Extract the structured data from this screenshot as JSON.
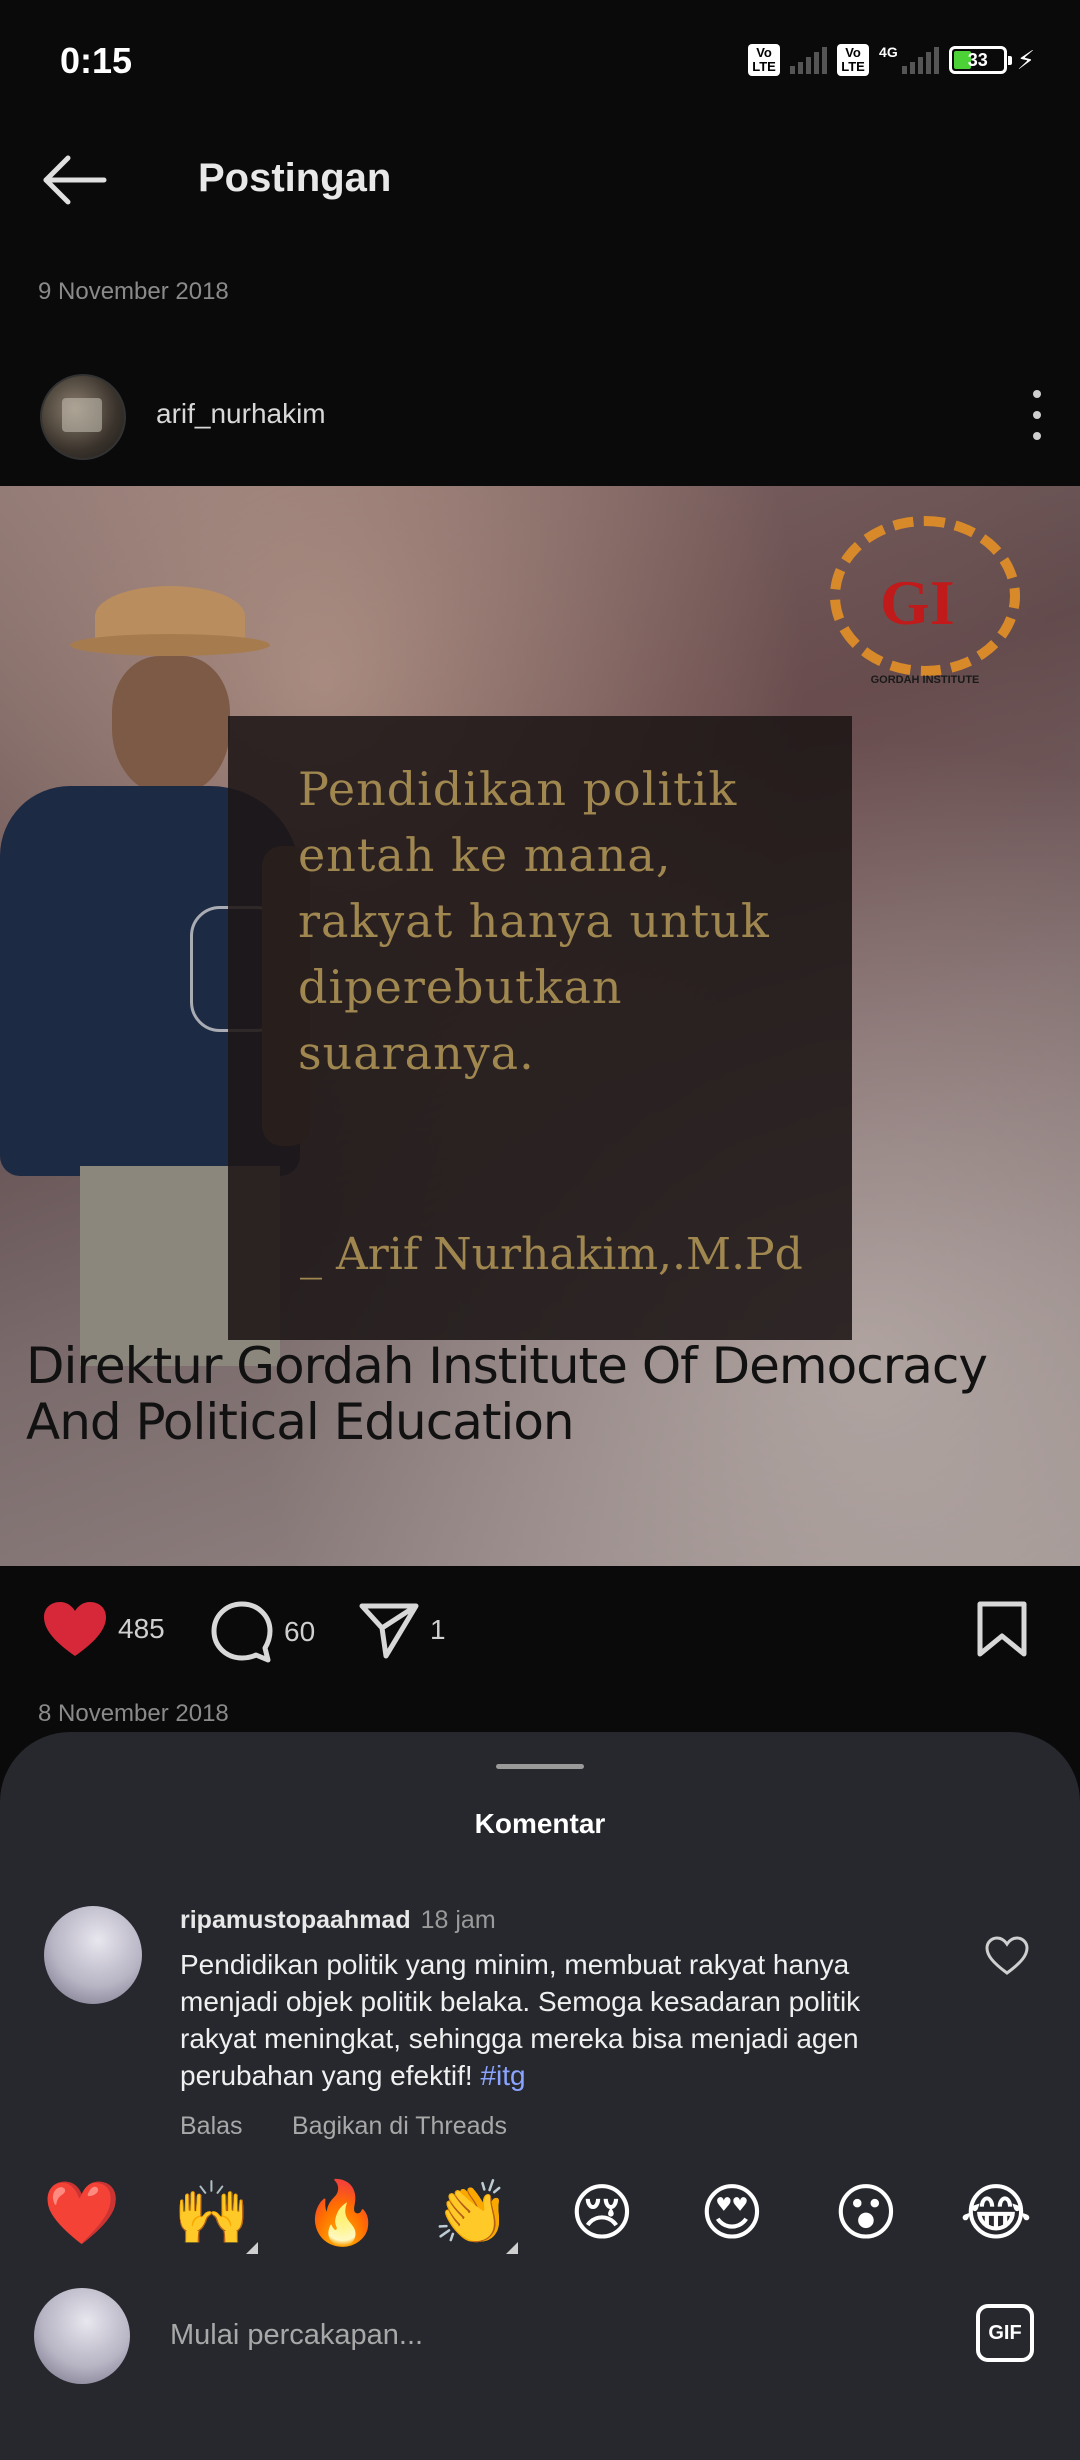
{
  "status_bar": {
    "time": "0:15",
    "volte": "Vo LTE",
    "network": "4G",
    "battery": "33"
  },
  "header": {
    "back_icon": "arrow-left-icon",
    "title": "Postingan"
  },
  "post": {
    "date_top": "9 November 2018",
    "author": "arif_nurhakim",
    "image": {
      "quote": "Pendidikan politik entah ke mana, rakyat hanya untuk diperebutkan suaranya.",
      "quote_author": "_ Arif Nurhakim,.M.Pd",
      "caption": "Direktur Gordah Institute Of Democracy And Political Education",
      "logo_letters": "GI",
      "logo_text": "GORDAH INSTITUTE"
    },
    "likes": "485",
    "comments": "60",
    "shares": "1",
    "date_bottom": "8 November 2018"
  },
  "comments_sheet": {
    "title": "Komentar",
    "comment": {
      "user": "ripamustopaahmad",
      "time": "18 jam",
      "text": "Pendidikan politik yang minim, membuat rakyat hanya menjadi objek politik belaka. Semoga kesadaran politik rakyat meningkat, sehingga mereka bisa menjadi agen perubahan yang efektif!",
      "hashtag": "#itg",
      "reply_label": "Balas",
      "share_label": "Bagikan di Threads"
    },
    "emojis": [
      "❤️",
      "🙌",
      "🔥",
      "👏",
      "😢",
      "😍",
      "😮",
      "😂"
    ],
    "composer_placeholder": "Mulai percakapan...",
    "gif_label": "GIF"
  },
  "colors": {
    "like": "#d62839",
    "hashtag": "#8aa4ff",
    "quote": "#a0874f"
  }
}
